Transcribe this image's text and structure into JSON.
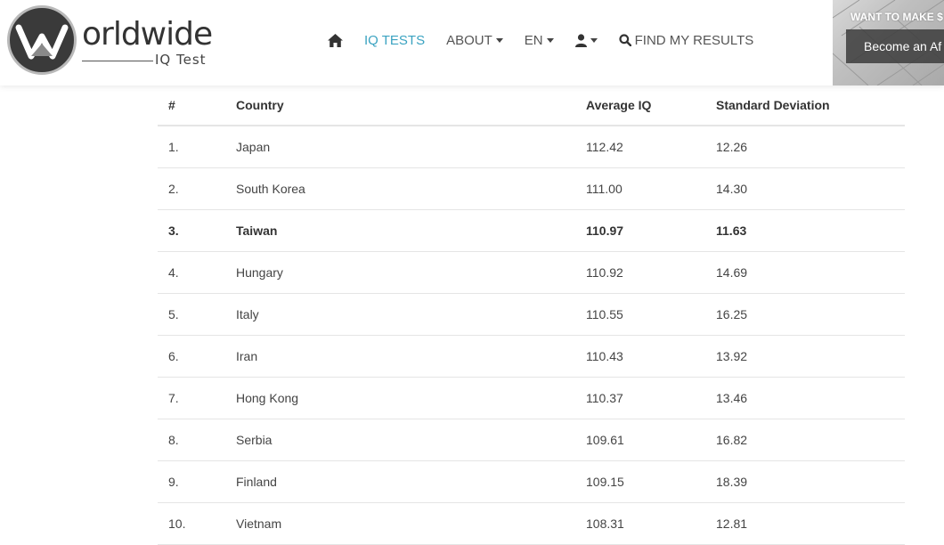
{
  "header": {
    "logo": {
      "word": "orldwide",
      "sub": "IQ Test"
    },
    "nav": [
      {
        "type": "icon",
        "icon": "home-icon"
      },
      {
        "type": "text",
        "label": "IQ TESTS",
        "active": true
      },
      {
        "type": "dropdown",
        "label": "ABOUT"
      },
      {
        "type": "dropdown",
        "label": "EN"
      },
      {
        "type": "icon-dropdown",
        "icon": "user-icon"
      },
      {
        "type": "icon-text",
        "icon": "search-icon",
        "label": "FIND MY RESULTS"
      }
    ],
    "promo": {
      "title": "WANT TO MAKE $",
      "button_label": "Become an Af"
    }
  },
  "colors": {
    "accent": "#3ba3c1",
    "text": "#333333",
    "border": "#e5e5e5"
  },
  "table": {
    "columns": [
      "#",
      "Country",
      "Average IQ",
      "Standard Deviation"
    ],
    "rows": [
      {
        "rank": "1.",
        "country": "Japan",
        "avg": "112.42",
        "sd": "12.26",
        "highlight": false
      },
      {
        "rank": "2.",
        "country": "South Korea",
        "avg": "111.00",
        "sd": "14.30",
        "highlight": false
      },
      {
        "rank": "3.",
        "country": "Taiwan",
        "avg": "110.97",
        "sd": "11.63",
        "highlight": true
      },
      {
        "rank": "4.",
        "country": "Hungary",
        "avg": "110.92",
        "sd": "14.69",
        "highlight": false
      },
      {
        "rank": "5.",
        "country": "Italy",
        "avg": "110.55",
        "sd": "16.25",
        "highlight": false
      },
      {
        "rank": "6.",
        "country": "Iran",
        "avg": "110.43",
        "sd": "13.92",
        "highlight": false
      },
      {
        "rank": "7.",
        "country": "Hong Kong",
        "avg": "110.37",
        "sd": "13.46",
        "highlight": false
      },
      {
        "rank": "8.",
        "country": "Serbia",
        "avg": "109.61",
        "sd": "16.82",
        "highlight": false
      },
      {
        "rank": "9.",
        "country": "Finland",
        "avg": "109.15",
        "sd": "18.39",
        "highlight": false
      },
      {
        "rank": "10.",
        "country": "Vietnam",
        "avg": "108.31",
        "sd": "12.81",
        "highlight": false
      }
    ]
  }
}
